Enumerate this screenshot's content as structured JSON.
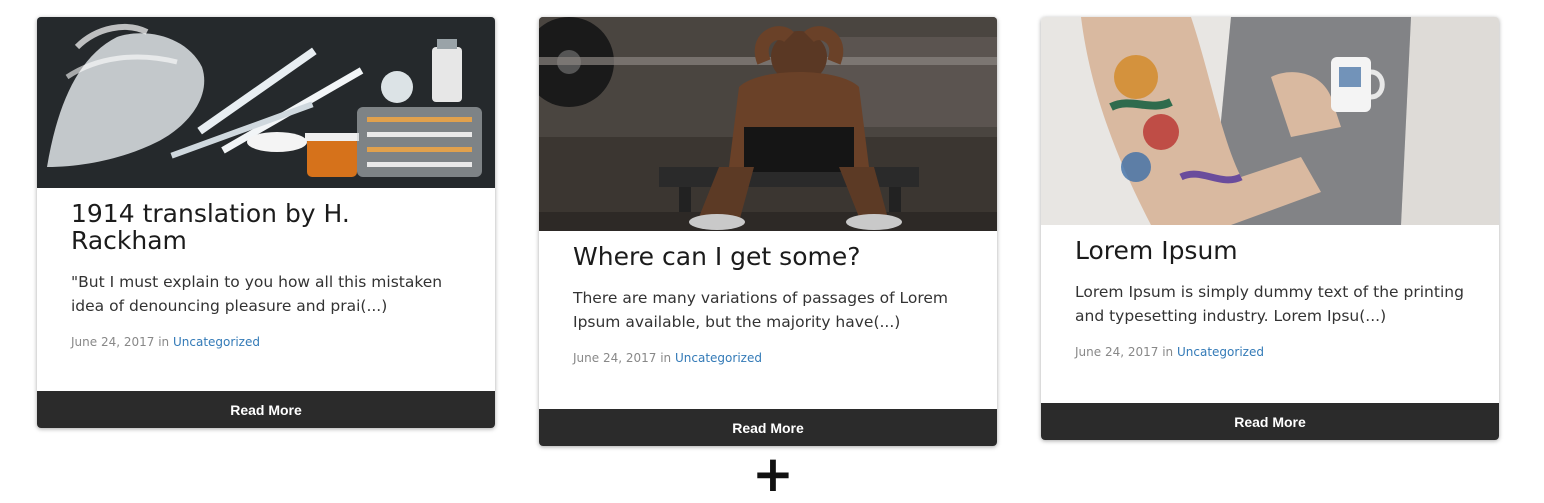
{
  "cards": [
    {
      "title": "1914 translation by H. Rackham",
      "excerpt": "\"But I must explain to you how all this mistaken idea of denouncing pleasure and prai(...)",
      "date": "June 24, 2017",
      "in_text": "in",
      "category": "Uncategorized",
      "button": "Read More"
    },
    {
      "title": "Where can I get some?",
      "excerpt": "There are many variations of passages of Lorem Ipsum available, but the majority have(...)",
      "date": "June 24, 2017",
      "in_text": "in",
      "category": "Uncategorized",
      "button": "Read More"
    },
    {
      "title": "Lorem Ipsum",
      "excerpt": "Lorem Ipsum is simply dummy text of the printing and typesetting industry. Lorem Ipsu(...)",
      "date": "June 24, 2017",
      "in_text": "in",
      "category": "Uncategorized",
      "button": "Read More"
    }
  ],
  "add_button": "+",
  "colors": {
    "button_bg": "#2b2b2b",
    "link": "#337ab7",
    "meta": "#888888"
  }
}
